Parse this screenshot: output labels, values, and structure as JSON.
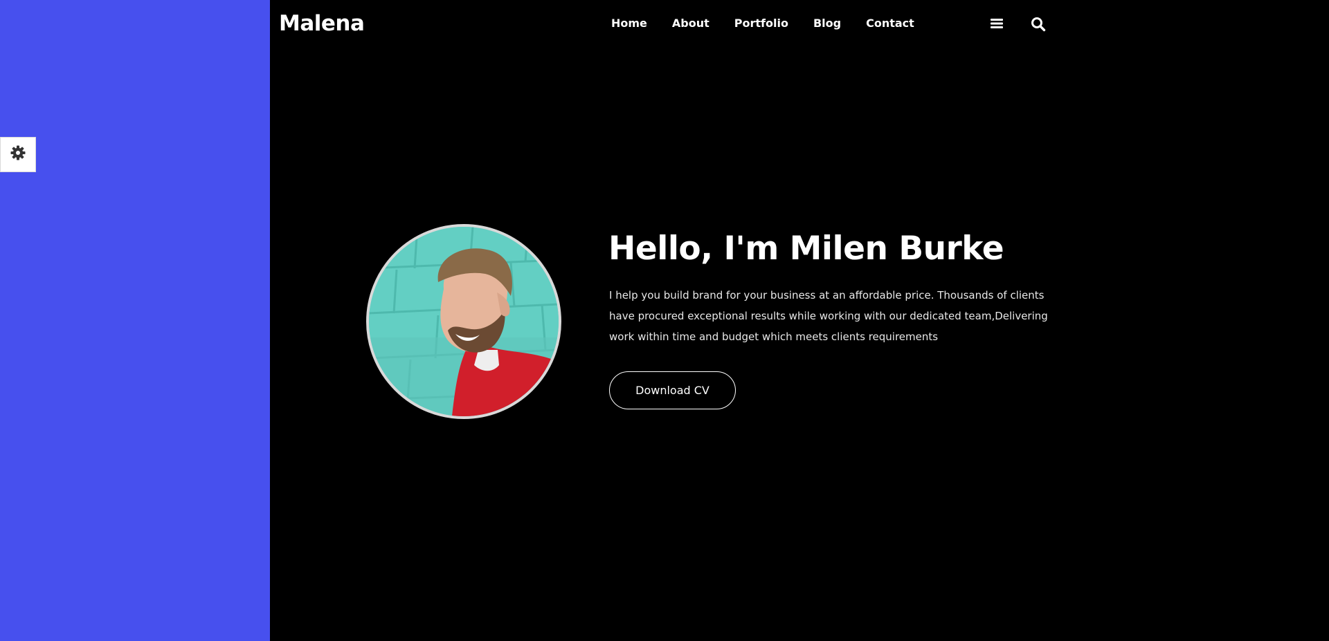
{
  "brand": {
    "logo_text": "Malena"
  },
  "nav": {
    "items": [
      {
        "label": "Home"
      },
      {
        "label": "About"
      },
      {
        "label": "Portfolio"
      },
      {
        "label": "Blog"
      },
      {
        "label": "Contact"
      }
    ]
  },
  "header_icons": {
    "menu": "hamburger-menu-icon",
    "search": "search-icon"
  },
  "settings": {
    "icon": "gear-icon"
  },
  "hero": {
    "title": "Hello, I'm Milen Burke",
    "description": "I help you build brand for your business at an affordable price. Thousands of clients have procured exceptional results while working with our dedicated team,Delivering work within time and budget which meets clients requirements",
    "cta_label": "Download CV",
    "avatar_icon": "profile-photo"
  },
  "colors": {
    "accent_panel": "#4750ee",
    "background": "#000000",
    "text": "#ffffff",
    "avatar_border": "#d9d9d9"
  }
}
